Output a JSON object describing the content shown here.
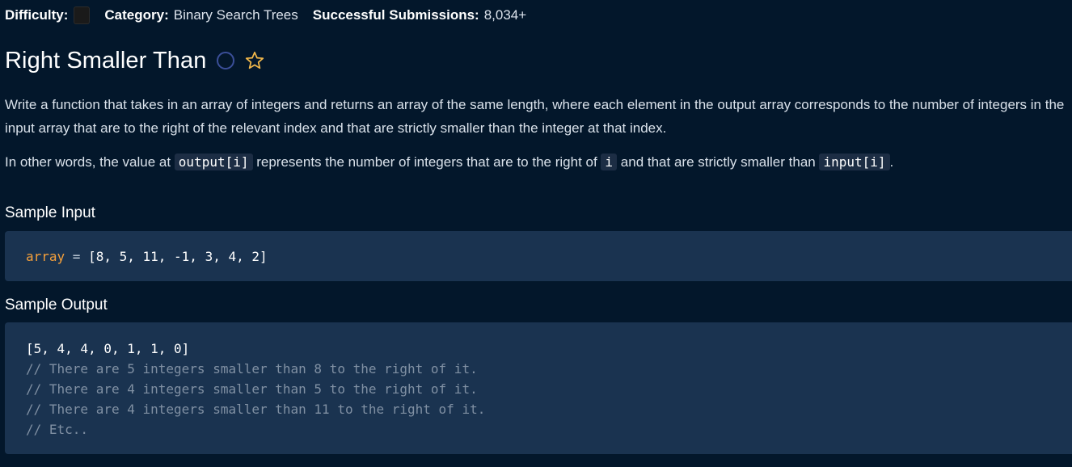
{
  "meta": {
    "difficulty_label": "Difficulty:",
    "category_label": "Category:",
    "category_value": "Binary Search Trees",
    "submissions_label": "Successful Submissions:",
    "submissions_value": "8,034+"
  },
  "problem": {
    "title": "Right Smaller Than",
    "icons": {
      "completion": "circle-icon",
      "favorite": "star-icon"
    },
    "description": {
      "para1": "Write a function that takes in an array of integers and returns an array of the same length, where each element in the output array corresponds to the number of integers in the input array that are to the right of the relevant index and that are strictly smaller than the integer at that index.",
      "para2_part1": "In other words, the value at ",
      "para2_code1": "output[i]",
      "para2_part2": " represents the number of integers that are to the right of ",
      "para2_code2": "i",
      "para2_part3": " and that are strictly smaller than ",
      "para2_code3": "input[i]",
      "para2_part4": "."
    }
  },
  "sample_input": {
    "heading": "Sample Input",
    "var_name": "array",
    "equals": " = ",
    "value": "[8, 5, 11, -1, 3, 4, 2]"
  },
  "sample_output": {
    "heading": "Sample Output",
    "result": "[5, 4, 4, 0, 1, 1, 0]",
    "comments": [
      "// There are 5 integers smaller than 8 to the right of it.",
      "// There are 4 integers smaller than 5 to the right of it.",
      "// There are 4 integers smaller than 11 to the right of it.",
      "// Etc.."
    ]
  },
  "colors": {
    "background": "#03172b",
    "code_background": "#1a3350",
    "inline_code_background": "#1c2d44",
    "keyword": "#f5a03b",
    "comment": "#8090a3",
    "star": "#f2b84b",
    "circle": "#3b4f99"
  }
}
